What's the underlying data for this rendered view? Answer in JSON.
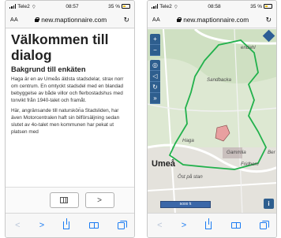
{
  "left_phone": {
    "status": {
      "carrier": "Tele2",
      "time": "08:57",
      "battery": "35 %"
    },
    "address": {
      "text_size": "AA",
      "url": "new.maptionnaire.com",
      "reload_glyph": "↻"
    },
    "page": {
      "title": "Välkommen till dialog",
      "subtitle": "Bakgrund till enkäten",
      "paragraph1": "Haga är en av Umeås äldsta stadsdelar, strax norr om centrum. En omtyckt stadsdel med en blandad bebyggelse av både villor och flerbostadshus med tonvikt från 1940-talet och framåt.",
      "paragraph2": "Här, angränsande till naturskön̈a Stadsliden, har även Motorcentralen haft sin bilförsäljning sedan slutet av 4o-talet men kommunen har pekat ut platsen med"
    },
    "pager": {
      "next_glyph": ">",
      "map_icon": "map-icon"
    },
    "toolbar": {
      "back": "<",
      "forward": ">",
      "share_icon": "share-icon",
      "bookmarks_icon": "book-icon",
      "tabs_icon": "tabs-icon"
    }
  },
  "right_phone": {
    "status": {
      "carrier": "Tele2",
      "time": "08:58",
      "battery": "35 %"
    },
    "address": {
      "text_size": "AA",
      "url": "new.maptionnaire.com",
      "reload_glyph": "↻"
    },
    "map": {
      "labels": {
        "sandbacka": "Sandbacka",
        "haga": "Haga",
        "gammlia": "Gammlia",
        "city": "Umeå",
        "ost_pa_stan": "Öst på stan",
        "fridhem": "Fridhem",
        "bendahl": "endahl",
        "ber": "Ber"
      },
      "controls": [
        "+",
        "−",
        "◎",
        "◁",
        "↻",
        "»"
      ],
      "scale": "5000 ft",
      "info": "i"
    },
    "toolbar": {
      "back": "<",
      "forward": ">",
      "share_icon": "share-icon",
      "bookmarks_icon": "book-icon",
      "tabs_icon": "tabs-icon"
    }
  },
  "colors": {
    "accent": "#1a7bf2",
    "boundary": "#22b14c",
    "marker": "#e8a0a0",
    "control": "#2e5e8e"
  }
}
